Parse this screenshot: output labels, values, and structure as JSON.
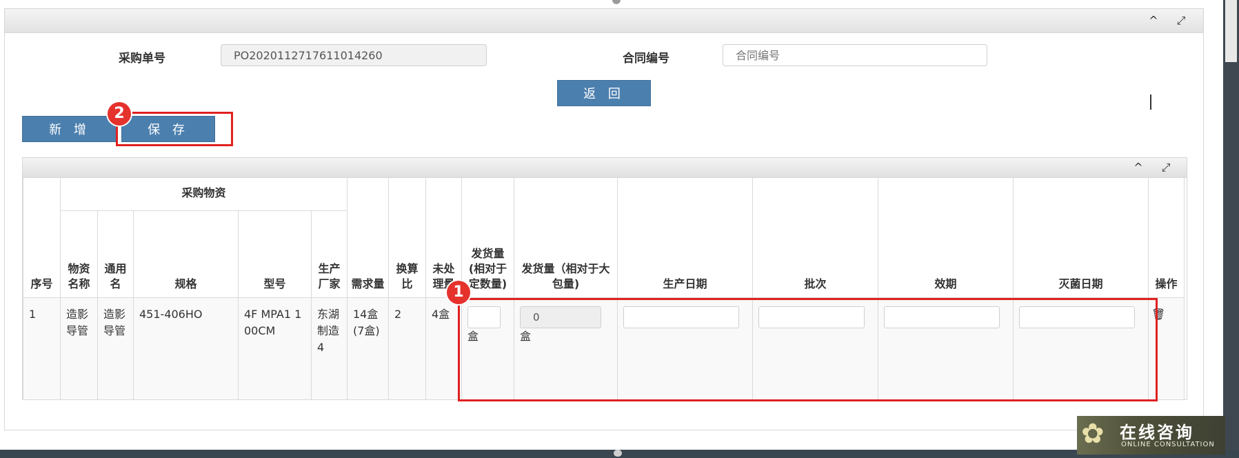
{
  "form": {
    "order_no_label": "采购单号",
    "order_no_value": "PO2020112717611014260",
    "contract_label": "合同编号",
    "contract_placeholder": "合同编号",
    "back_label": "返 回",
    "add_label": "新 增",
    "save_label": "保 存"
  },
  "panel_controls": {
    "collapse": "^",
    "expand": "⤢"
  },
  "annotations": {
    "badge1": "1",
    "badge2": "2"
  },
  "table": {
    "group_header": "采购物资",
    "headers": {
      "seq": "序号",
      "name": "物资名称",
      "common": "通用名",
      "spec": "规格",
      "model": "型号",
      "maker": "生产厂家",
      "demand": "需求量",
      "ratio": "换算比",
      "pending": "未处理量",
      "ship_fixed": "发货量(相对于定数量)",
      "ship_big": "发货量（相对于大包量)",
      "prod_date": "生产日期",
      "batch": "批次",
      "expiry": "效期",
      "steril_date": "灭菌日期",
      "op": "操作"
    },
    "rows": [
      {
        "seq": "1",
        "name": "造影导管",
        "common": "造影导管",
        "spec": "451-406HO",
        "model": "4F MPA1 100CM",
        "maker": "东湖制造4",
        "demand": "14盒(7盒)",
        "ratio": "2",
        "pending": "4盒",
        "ship_fixed_value": "",
        "ship_fixed_unit": "盒",
        "ship_big_value": "0",
        "ship_big_unit": "盒",
        "op_icon": "trash-icon",
        "op_glyph": "🗑"
      }
    ]
  },
  "consult": {
    "zh": "在线咨询",
    "en": "ONLINE CONSULTATION"
  }
}
